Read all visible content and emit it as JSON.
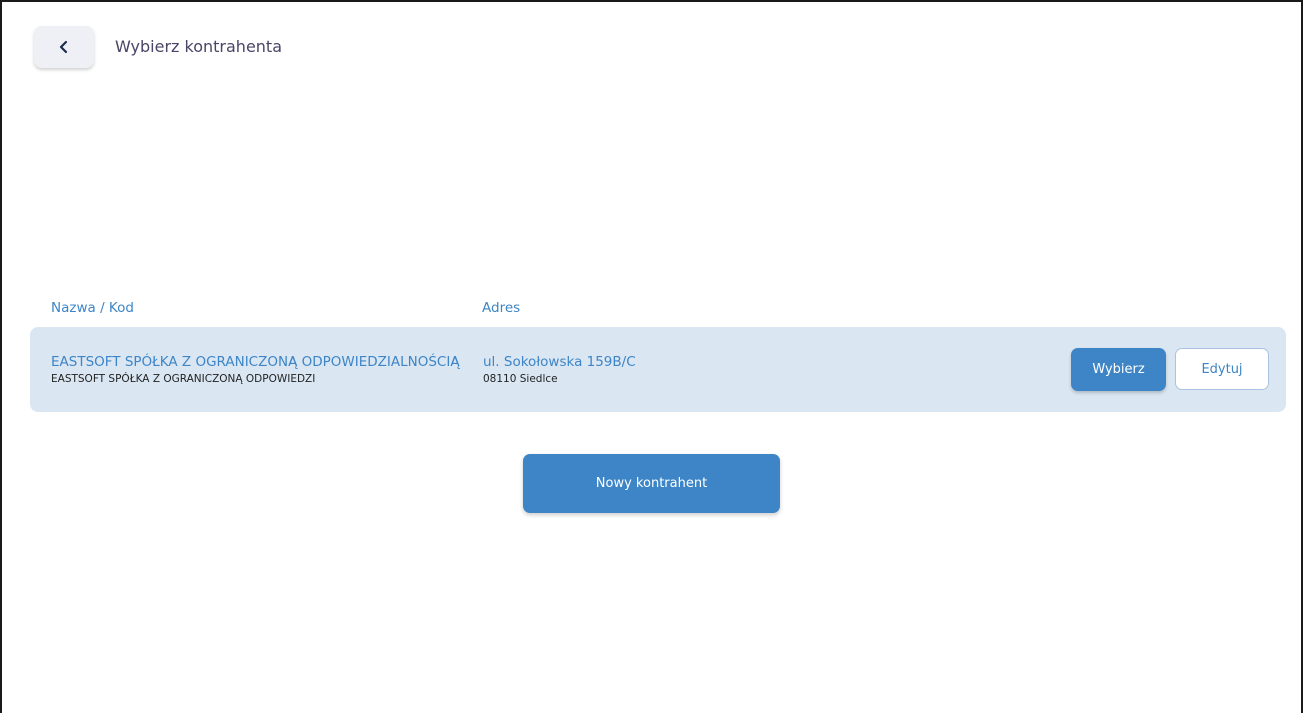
{
  "header": {
    "back_icon": "chevron-left-icon",
    "title": "Wybierz kontrahenta"
  },
  "table": {
    "columns": [
      "Nazwa / Kod",
      "Adres"
    ],
    "rows": [
      {
        "name": "EASTSOFT SPÓŁKA Z OGRANICZONĄ ODPOWIEDZIALNOŚCIĄ",
        "code": "EASTSOFT SPÓŁKA Z OGRANICZONĄ ODPOWIEDZI",
        "street": "ul. Sokołowska 159B/C",
        "city": "08110 Siedlce",
        "select_label": "Wybierz",
        "edit_label": "Edytuj"
      }
    ]
  },
  "actions": {
    "new_label": "Nowy kontrahent"
  },
  "colors": {
    "accent": "#3d85c6",
    "row_background": "#dae7f3",
    "title_text": "#4a4566"
  }
}
